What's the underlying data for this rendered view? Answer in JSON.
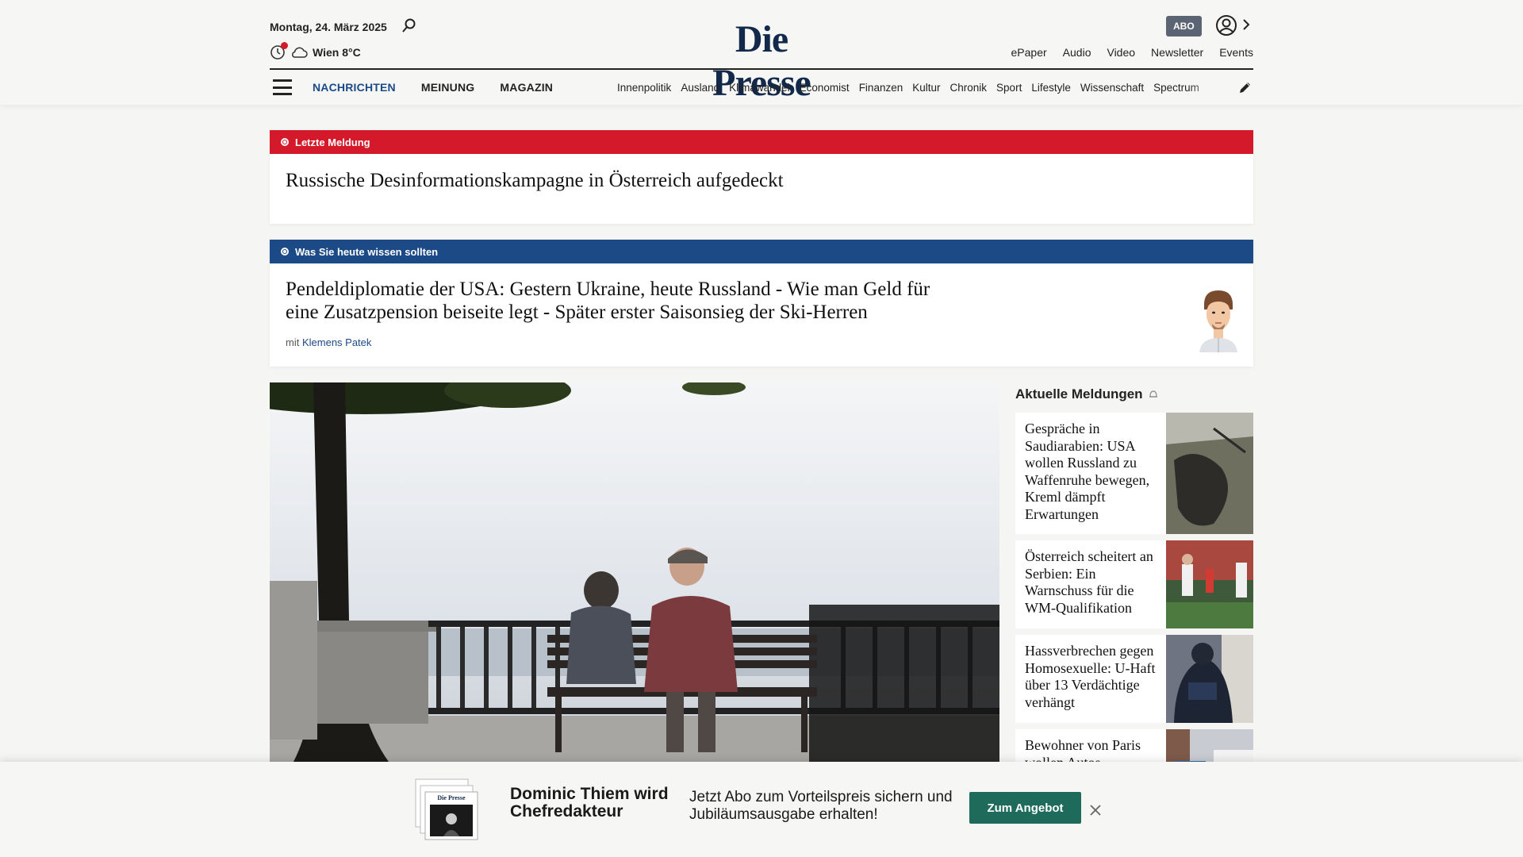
{
  "header": {
    "date": "Montag, 24. März 2025",
    "weather": "Wien 8°C",
    "logo": "Die Presse",
    "abo_label": "ABO",
    "top_links": [
      "ePaper",
      "Audio",
      "Video",
      "Newsletter",
      "Events"
    ]
  },
  "nav": {
    "main": [
      "NACHRICHTEN",
      "MEINUNG",
      "MAGAZIN"
    ],
    "sub": [
      "Innenpolitik",
      "Ausland",
      "Klimawandel",
      "Economist",
      "Finanzen",
      "Kultur",
      "Chronik",
      "Sport",
      "Lifestyle",
      "Wissenschaft",
      "Spectrum"
    ]
  },
  "breaking": {
    "label": "Letzte Meldung",
    "title": "Russische Desinformationskampagne in Österreich aufgedeckt"
  },
  "briefing": {
    "label": "Was Sie heute wissen sollten",
    "title": "Pendeldiplomatie der USA: Gestern Ukraine, heute Russland - Wie man Geld für eine Zusatzpension beiseite legt - Später erster Saisonsieg der Ski-Herren",
    "byline_prefix": "mit",
    "author": "Klemens Patek"
  },
  "sidebar": {
    "heading": "Aktuelle Meldungen",
    "items": [
      {
        "title": "Gespräche in Saudiarabien: USA wollen Russland zu Waffenruhe bewegen, Kreml dämpft Erwartungen"
      },
      {
        "title": "Österreich scheitert an Serbien: Ein Warnschuss für die WM-Qualifikation"
      },
      {
        "title": "Hassverbrechen gegen Homosexuelle: U-Haft über 13 Verdächtige verhängt"
      },
      {
        "title": "Bewohner von Paris wollen Autos"
      }
    ]
  },
  "banner": {
    "headline": "Dominic Thiem wird Chefredakteur",
    "offer": "Jetzt Abo zum Vorteilspreis sichern und Jubiläumsausgabe erhalten!",
    "cta": "Zum Angebot"
  },
  "colors": {
    "brand_navy": "#13294b",
    "breaking_red": "#d4192a",
    "briefing_blue": "#1c4a87",
    "cta_green": "#1f6b5b"
  }
}
